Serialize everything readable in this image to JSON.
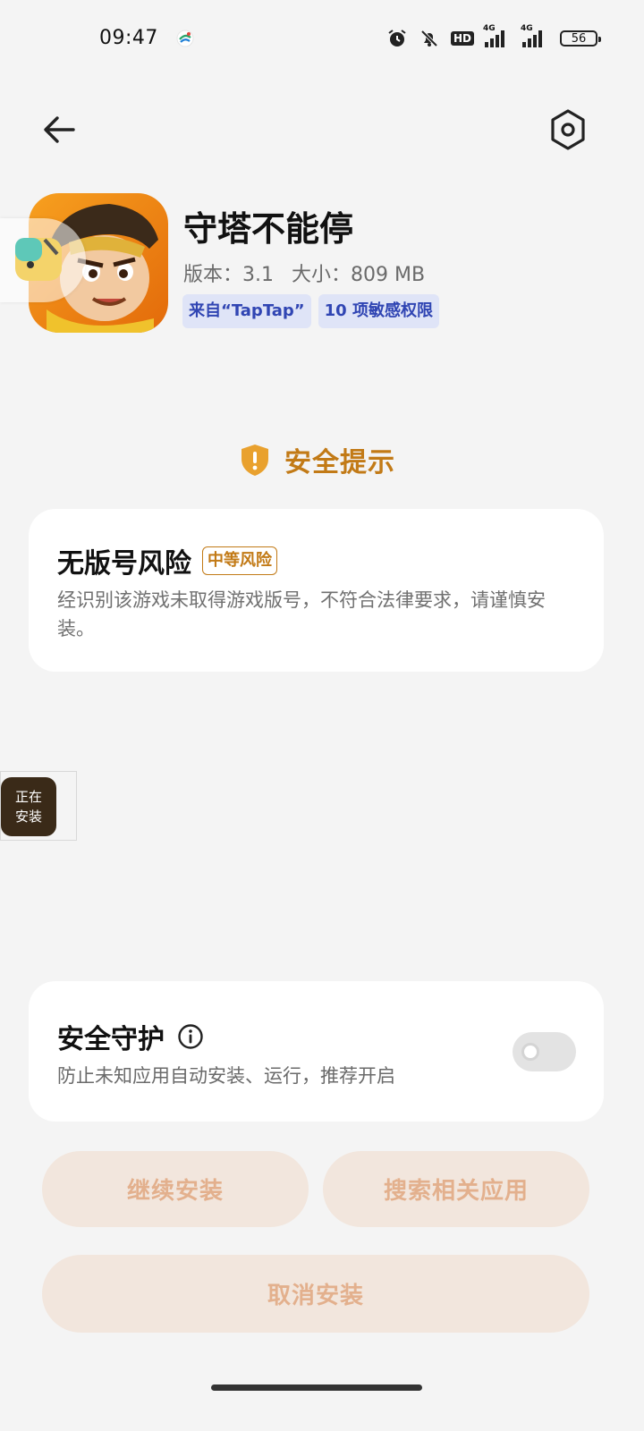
{
  "status_bar": {
    "time": "09:47",
    "network1": "4G",
    "network2": "4G",
    "hd_label": "HD",
    "battery": "56",
    "icons": [
      "alarm-icon",
      "mute-icon",
      "hd-icon",
      "signal-icon",
      "signal-icon",
      "battery-icon"
    ]
  },
  "header": {
    "back_icon": "arrow-left-icon",
    "settings_icon": "hexagon-gear-icon"
  },
  "app": {
    "name": "守塔不能停",
    "version": "版本：3.1",
    "size": "大小：809 MB",
    "tags": [
      "来自“TapTap”",
      "10 项敏感权限"
    ]
  },
  "security_notice": {
    "title": "安全提示",
    "icon": "shield-alert-icon",
    "risk_title": "无版号风险",
    "risk_level": "中等风险",
    "risk_description": "经识别该游戏未取得游戏版号，不符合法律要求，请谨慎安装。"
  },
  "installing_badge": {
    "label_line1": "正在",
    "label_line2": "安装"
  },
  "guard": {
    "title": "安全守护",
    "info_icon": "info-icon",
    "description": "防止未知应用自动安装、运行，推荐开启",
    "enabled": false
  },
  "buttons": {
    "continue": "继续安装",
    "search": "搜索相关应用",
    "cancel": "取消安装"
  },
  "colors": {
    "accent": "#c27a16",
    "tag_bg": "#dfe4f7",
    "tag_text": "#3045b3",
    "button_bg": "#f2e6dd",
    "button_text": "#e3b08d"
  }
}
